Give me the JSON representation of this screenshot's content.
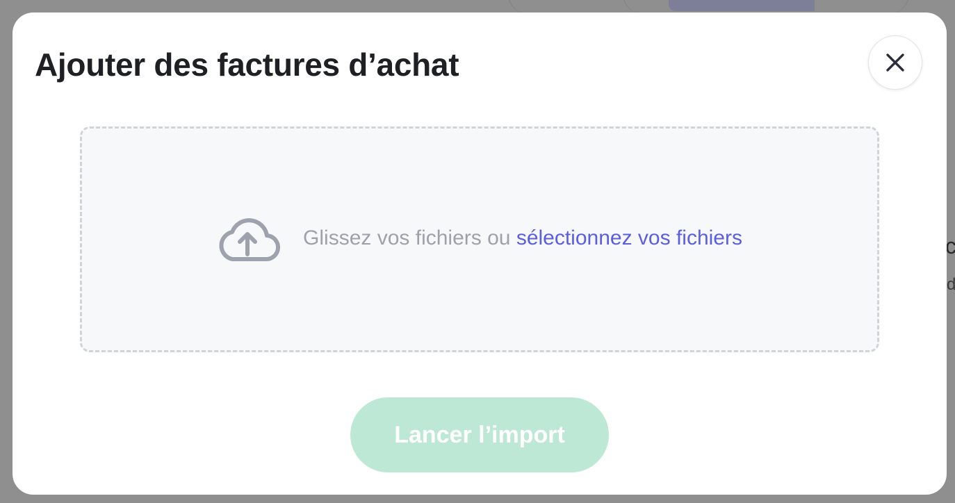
{
  "modal": {
    "title": "Ajouter des factures d’achat",
    "close_icon": "close-icon"
  },
  "dropzone": {
    "icon": "cloud-upload-icon",
    "prompt_text": "Glissez vos fichiers ou ",
    "link_text": "sélectionnez vos fichiers"
  },
  "actions": {
    "import_label": "Lancer l’import"
  },
  "background": {
    "fragment_1": "c",
    "fragment_2": "d"
  },
  "colors": {
    "link": "#5b5ee0",
    "import_button_disabled": "#bde8d5",
    "overlay": "#8f8f8f"
  }
}
